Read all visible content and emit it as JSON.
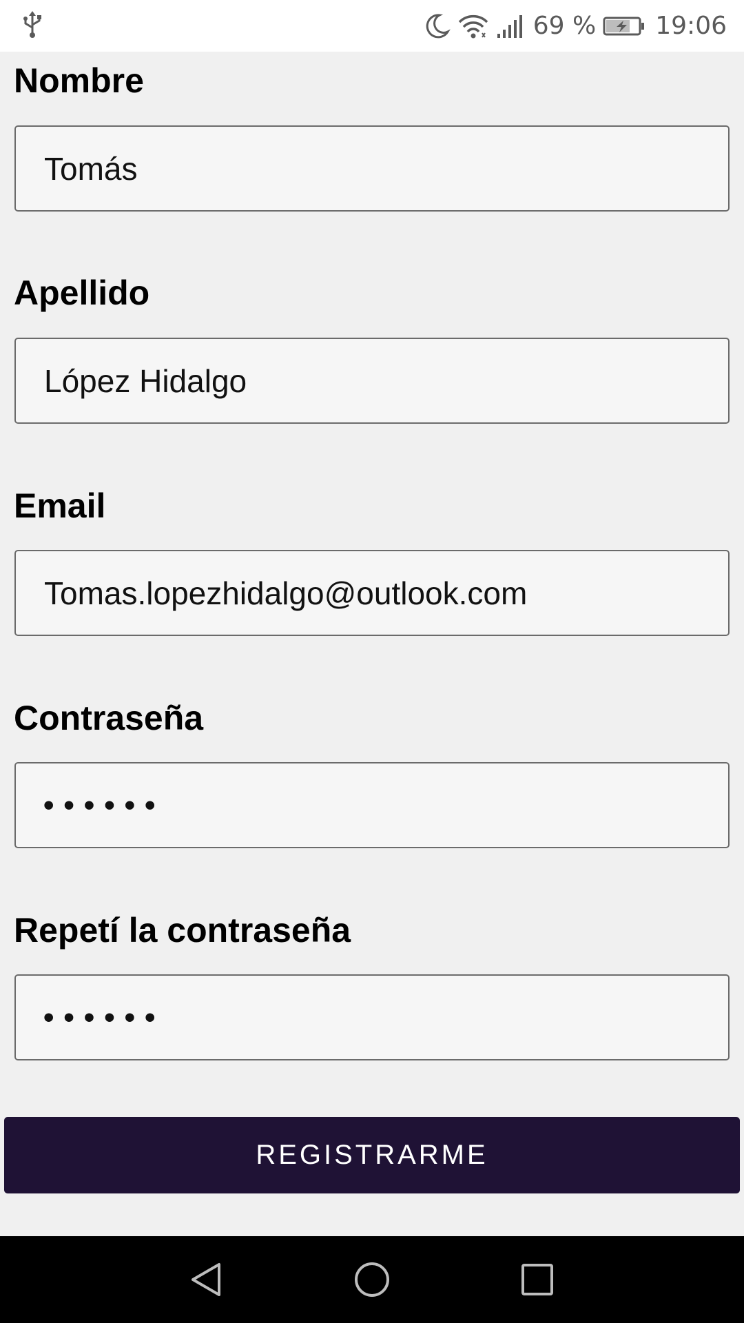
{
  "status_bar": {
    "usb_icon": "usb-icon",
    "moon_icon": "do-not-disturb-moon-icon",
    "wifi_icon": "wifi-icon",
    "signal_icon": "cell-signal-icon",
    "battery_percent": "69 %",
    "battery_icon": "battery-charging-icon",
    "time": "19:06"
  },
  "form": {
    "fields": [
      {
        "label": "Nombre",
        "value": "Tomás"
      },
      {
        "label": "Apellido",
        "value": "López Hidalgo"
      },
      {
        "label": "Email",
        "value": "Tomas.lopezhidalgo@outlook.com"
      },
      {
        "label": "Contraseña",
        "value": "••••••"
      },
      {
        "label": "Repetí la contraseña",
        "value": "••••••"
      }
    ],
    "submit_label": "REGISTRARME"
  },
  "nav_bar": {
    "back_icon": "back-triangle-icon",
    "home_icon": "home-circle-icon",
    "recents_icon": "recents-square-icon"
  },
  "colors": {
    "button_bg": "#1f1235",
    "page_bg": "#f0f0f0",
    "input_bg": "#f6f6f6",
    "input_border": "#6b6b6b"
  }
}
